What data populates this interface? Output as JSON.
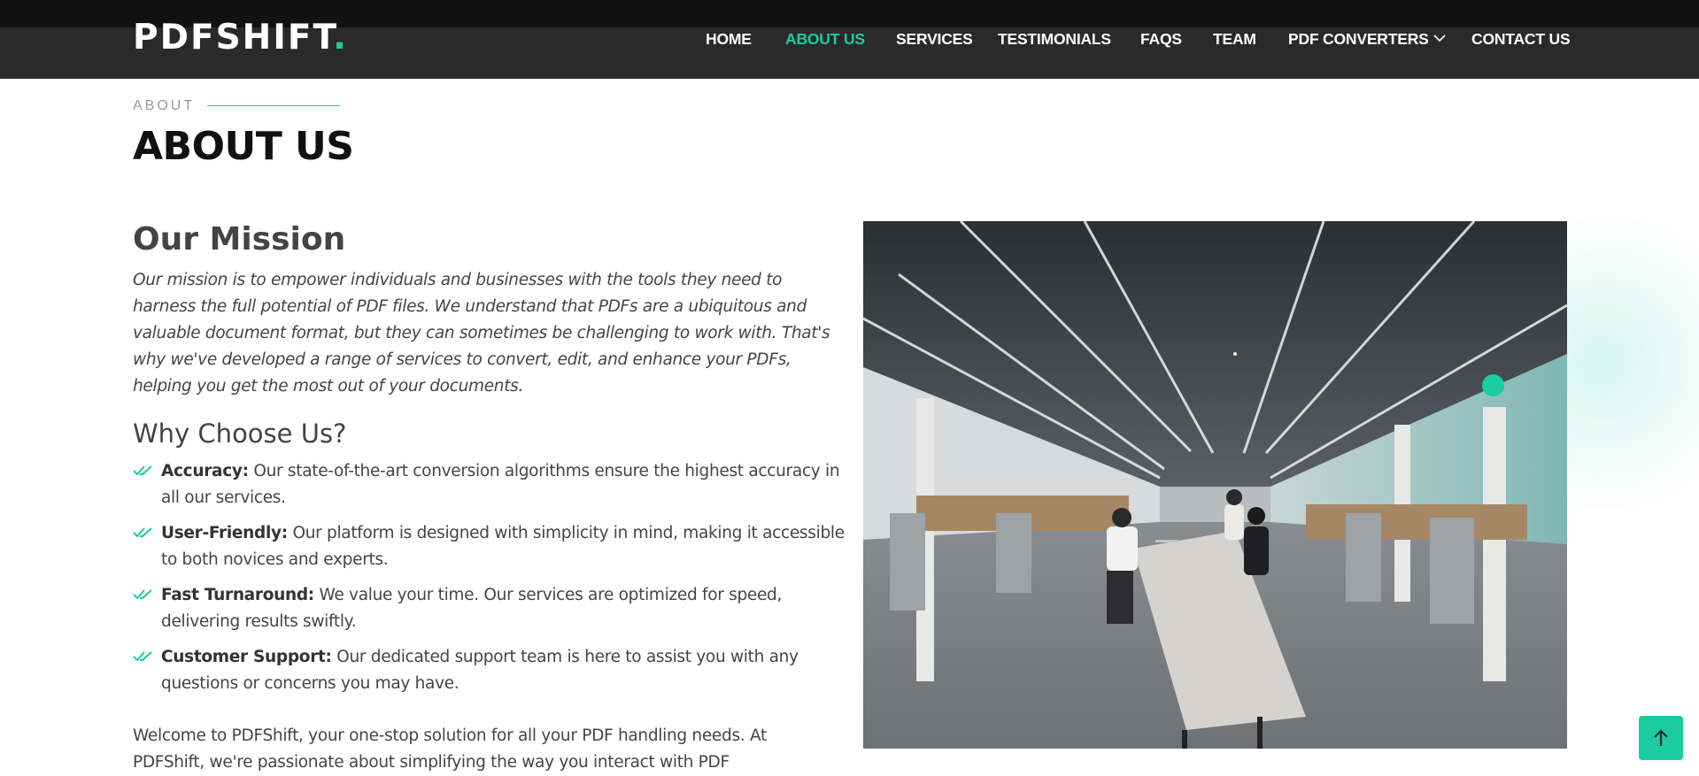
{
  "header": {
    "logo_text": "PDFSHIFT",
    "logo_dot": ".",
    "nav": [
      {
        "label": "HOME",
        "active": false
      },
      {
        "label": "ABOUT US",
        "active": true
      },
      {
        "label": "SERVICES",
        "active": false
      },
      {
        "label": "TESTIMONIALS",
        "active": false
      },
      {
        "label": "FAQS",
        "active": false
      },
      {
        "label": "TEAM",
        "active": false
      },
      {
        "label": "PDF CONVERTERS",
        "active": false,
        "has_dropdown": true
      },
      {
        "label": "CONTACT US",
        "active": false
      }
    ]
  },
  "section": {
    "eyebrow": "ABOUT",
    "title": "ABOUT US"
  },
  "mission": {
    "title": "Our Mission",
    "text": "Our mission is to empower individuals and businesses with the tools they need to harness the full potential of PDF files. We understand that PDFs are a ubiquitous and valuable document format, but they can sometimes be challenging to work with. That's why we've developed a range of services to convert, edit, and enhance your PDFs, helping you get the most out of your documents."
  },
  "why": {
    "title": "Why Choose Us?",
    "items": [
      {
        "label": "Accuracy:",
        "text": " Our state-of-the-art conversion algorithms ensure the highest accuracy in all our services."
      },
      {
        "label": "User-Friendly:",
        "text": " Our platform is designed with simplicity in mind, making it accessible to both novices and experts."
      },
      {
        "label": "Fast Turnaround:",
        "text": " We value your time. Our services are optimized for speed, delivering results swiftly."
      },
      {
        "label": "Customer Support:",
        "text": " Our dedicated support team is here to assist you with any questions or concerns you may have."
      }
    ]
  },
  "welcome": {
    "text": "Welcome to PDFShift, your one-stop solution for all your PDF handling needs. At PDFShift, we're passionate about simplifying the way you interact with PDF"
  },
  "colors": {
    "accent": "#1acc9f",
    "header_bg": "#2a2a2a",
    "top_strip": "#111111"
  },
  "icons": {
    "checks": "double-check-icon",
    "dropdown": "chevron-down-icon",
    "back_to_top": "arrow-up-icon"
  }
}
